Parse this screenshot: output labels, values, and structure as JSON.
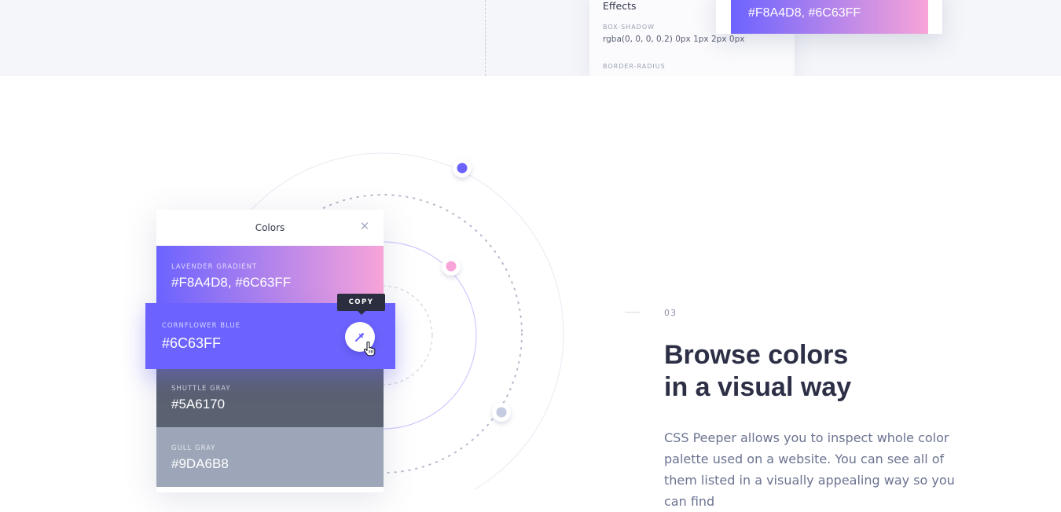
{
  "top_section": {
    "effects_panel": {
      "title": "Effects",
      "box_shadow_label": "BOX-SHADOW",
      "box_shadow_value": "rgba(0, 0, 0, 0.2) 0px 1px 2px 0px",
      "border_radius_label": "BORDER-RADIUS"
    },
    "gradient_card": {
      "value": "#F8A4D8, #6C63FF"
    }
  },
  "colors_panel": {
    "title": "Colors",
    "close_icon": "close-icon",
    "colors": [
      {
        "name": "LAVENDER GRADIENT",
        "value": "#F8A4D8, #6C63FF",
        "hex": [
          "#F8A4D8",
          "#6C63FF"
        ]
      },
      {
        "name": "CORNFLOWER BLUE",
        "value": "#6C63FF",
        "hex": "#6C63FF"
      },
      {
        "name": "SHUTTLE GRAY",
        "value": "#5A6170",
        "hex": "#5A6170"
      },
      {
        "name": "GULL GRAY",
        "value": "#9DA6B8",
        "hex": "#9DA6B8"
      }
    ],
    "copy_tooltip": "COPY",
    "picker_icon": "eyedropper-icon",
    "cursor_icon": "hand-pointer-icon"
  },
  "feature": {
    "step": "03",
    "headline_line1": "Browse colors",
    "headline_line2": "in a visual way",
    "body": "CSS Peeper allows you to inspect whole color palette used on a website. You can see all of them listed in a visually appealing way so you can find"
  },
  "colors": {
    "accent": "#6C63FF",
    "pink": "#F8A4D8",
    "text_dark": "#2C2F45",
    "text_muted": "#6B7390",
    "orbit_dot_light": "#C5CBE0"
  }
}
